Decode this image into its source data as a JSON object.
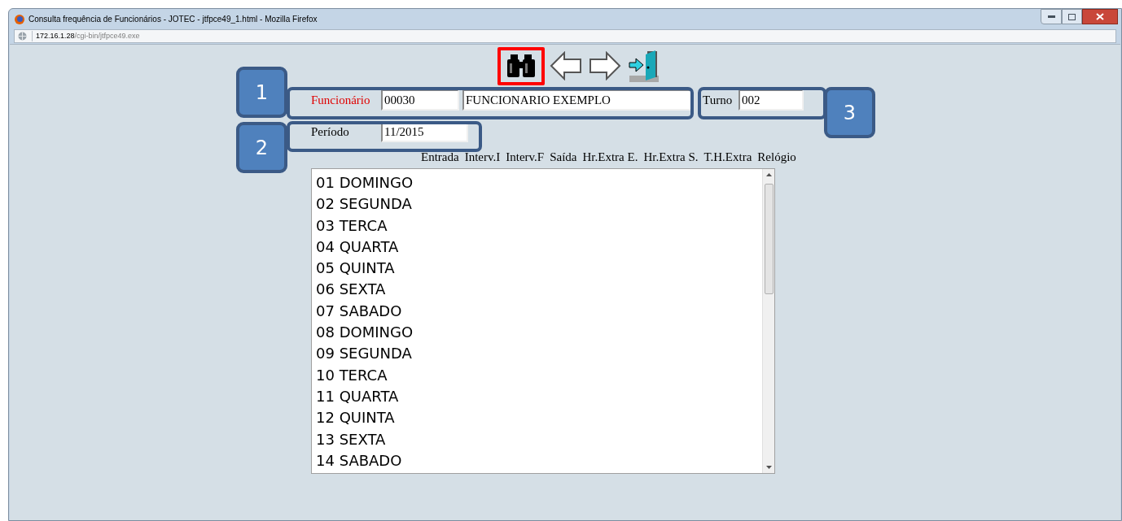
{
  "window": {
    "title": "Consulta frequência de Funcionários - JOTEC - jtfpce49_1.html - Mozilla Firefox"
  },
  "address": {
    "host": "172.16.1.28",
    "path": "/cgi-bin/jtfpce49.exe"
  },
  "toolbar": [
    {
      "kind": "search",
      "highlighted": true
    },
    {
      "kind": "back",
      "highlighted": false
    },
    {
      "kind": "forward",
      "highlighted": false
    },
    {
      "kind": "exit",
      "highlighted": false
    }
  ],
  "form": {
    "employee_label": "Funcionário",
    "employee_code": "00030",
    "employee_name": "FUNCIONARIO EXEMPLO",
    "shift_label": "Turno",
    "shift": "002",
    "period_label": "Período",
    "period": "11/2015"
  },
  "callouts": [
    "1",
    "2",
    "3"
  ],
  "columns": [
    "Entrada",
    "Interv.I",
    "Interv.F",
    "Saída",
    "Hr.Extra E.",
    "Hr.Extra S.",
    "T.H.Extra",
    "Relógio"
  ],
  "days": [
    "01 DOMINGO",
    "02 SEGUNDA",
    "03 TERCA",
    "04 QUARTA",
    "05 QUINTA",
    "06 SEXTA",
    "07 SABADO",
    "08 DOMINGO",
    "09 SEGUNDA",
    "10 TERCA",
    "11 QUARTA",
    "12 QUINTA",
    "13 SEXTA",
    "14 SABADO"
  ]
}
